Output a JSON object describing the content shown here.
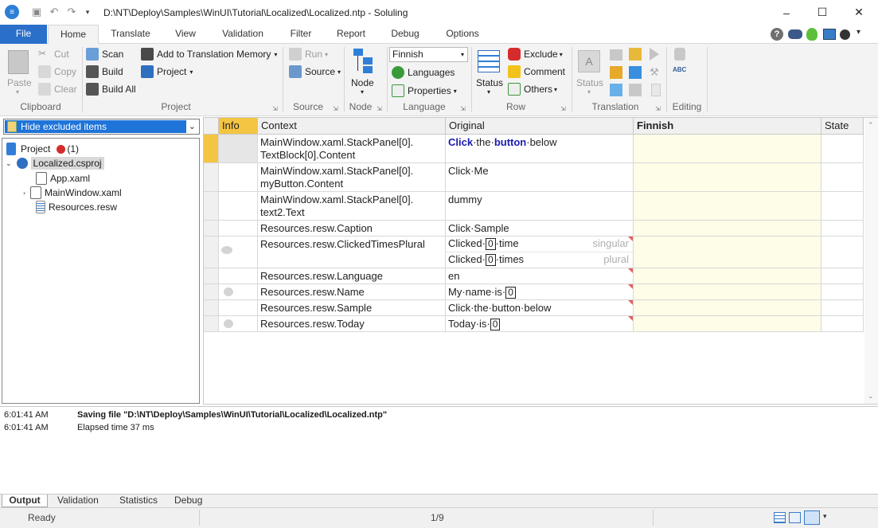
{
  "window": {
    "title": "D:\\NT\\Deploy\\Samples\\WinUI\\Tutorial\\Localized\\Localized.ntp  -  Soluling",
    "minimize": "–",
    "maximize": "☐",
    "close": "✕"
  },
  "tabs": [
    "File",
    "Home",
    "Translate",
    "View",
    "Validation",
    "Filter",
    "Report",
    "Debug",
    "Options"
  ],
  "ribbon": {
    "clipboard": {
      "paste": "Paste",
      "cut": "Cut",
      "copy": "Copy",
      "clear": "Clear",
      "group": "Clipboard"
    },
    "project": {
      "scan": "Scan",
      "build": "Build",
      "build_all": "Build All",
      "add_tm": "Add to Translation Memory",
      "project": "Project",
      "group": "Project"
    },
    "source": {
      "run": "Run",
      "source": "Source",
      "group": "Source"
    },
    "node": {
      "node": "Node",
      "group": "Node"
    },
    "language": {
      "selected": "Finnish",
      "languages": "Languages",
      "properties": "Properties",
      "group": "Language"
    },
    "row": {
      "status": "Status",
      "exclude": "Exclude",
      "comment": "Comment",
      "others": "Others",
      "group": "Row"
    },
    "translation": {
      "status": "Status",
      "group": "Translation"
    },
    "editing": {
      "group": "Editing"
    }
  },
  "filter_combo": "Hide excluded items",
  "tree": {
    "project": "Project",
    "project_count": "(1)",
    "csproj": "Localized.csproj",
    "items": [
      "App.xaml",
      "MainWindow.xaml",
      "Resources.resw"
    ]
  },
  "grid": {
    "columns": [
      "Info",
      "Context",
      "Original",
      "Finnish",
      "State"
    ],
    "rows": [
      {
        "context": "MainWindow.xaml.StackPanel[0].\nTextBlock[0].Content"
      },
      {
        "context": "MainWindow.xaml.StackPanel[0].\nmyButton.Content",
        "original": "Click·Me"
      },
      {
        "context": "MainWindow.xaml.StackPanel[0].\ntext2.Text",
        "original": "dummy"
      },
      {
        "context": "Resources.resw.Caption",
        "original": "Click·Sample"
      },
      {
        "context": "Resources.resw.ClickedTimesPlural"
      },
      {
        "context": "Resources.resw.Language",
        "original": "en"
      },
      {
        "context": "Resources.resw.Name"
      },
      {
        "context": "Resources.resw.Sample",
        "original": "Click·the·button·below"
      },
      {
        "context": "Resources.resw.Today"
      }
    ],
    "row1_parts": {
      "a": "Click",
      "b": "·the·",
      "c": "button",
      "d": "·below"
    },
    "plural": {
      "one_pre": "Clicked·",
      "one_post": "·time",
      "one_label": "singular",
      "other_pre": "Clicked·",
      "other_post": "·times",
      "other_label": "plural",
      "ph": "0"
    },
    "name_pre": "My·name·is·",
    "today_pre": "Today·is·",
    "ph": "0"
  },
  "output": {
    "lines": [
      {
        "time": "6:01:41 AM",
        "text": "Saving file \"D:\\NT\\Deploy\\Samples\\WinUI\\Tutorial\\Localized\\Localized.ntp\""
      },
      {
        "time": "6:01:41 AM",
        "text": "Elapsed time 37 ms"
      }
    ],
    "tabs": [
      "Output",
      "Validation",
      "Statistics",
      "Debug"
    ]
  },
  "status": {
    "ready": "Ready",
    "position": "1/9"
  }
}
